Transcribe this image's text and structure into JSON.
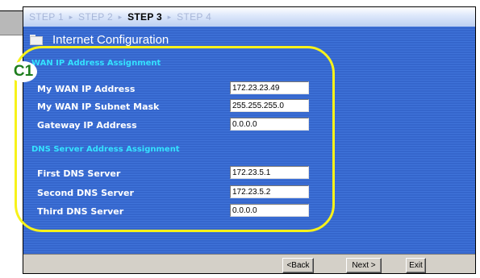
{
  "wizard": {
    "steps": [
      {
        "label": "STEP 1",
        "active": false
      },
      {
        "label": "STEP 2",
        "active": false
      },
      {
        "label": "STEP 3",
        "active": true
      },
      {
        "label": "STEP 4",
        "active": false
      }
    ],
    "step_separator": "▸",
    "title": "Internet Configuration",
    "title_icon": "folder-icon"
  },
  "wan": {
    "heading": "WAN IP Address Assignment",
    "ip_label": "My WAN IP Address",
    "ip_value": "172.23.23.49",
    "mask_label": "My WAN IP Subnet Mask",
    "mask_value": "255.255.255.0",
    "gateway_label": "Gateway IP Address",
    "gateway_value": "0.0.0.0"
  },
  "dns": {
    "heading": "DNS Server Address Assignment",
    "first_label": "First DNS Server",
    "first_value": "172.23.5.1",
    "second_label": "Second DNS Server",
    "second_value": "172.23.5.2",
    "third_label": "Third DNS Server",
    "third_value": "0.0.0.0"
  },
  "callout": {
    "label": "C1",
    "color": "#f7f21a",
    "text_color": "#1d7d1d"
  },
  "buttons": {
    "back": "<Back",
    "next": "Next >",
    "exit": "Exit"
  },
  "colors": {
    "panel_blue": "#3566cc",
    "section_heading": "#34e2ff",
    "active_step": "#000000",
    "inactive_step": "#a7b6d8"
  }
}
